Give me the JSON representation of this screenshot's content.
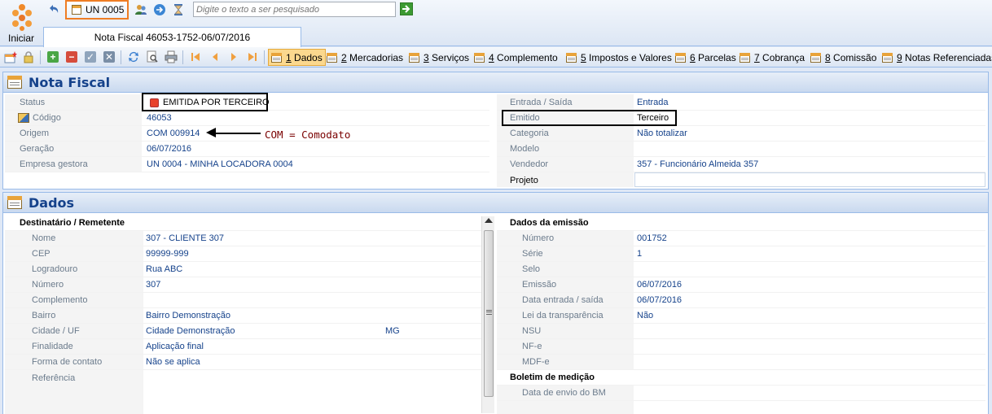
{
  "top": {
    "start_label": "Iniciar",
    "unit_label": "UN 0005",
    "search_placeholder": "Digite o texto a ser pesquisado"
  },
  "document_tab": "Nota Fiscal 46053-1752-06/07/2016",
  "nav_tabs": [
    {
      "num": "1",
      "label": " Dados",
      "active": true
    },
    {
      "num": "2",
      "label": " Mercadorias"
    },
    {
      "num": "3",
      "label": " Serviços"
    },
    {
      "num": "4",
      "label": " Complemento"
    },
    {
      "num": "5",
      "label": " Impostos e Valores"
    },
    {
      "num": "6",
      "label": " Parcelas"
    },
    {
      "num": "7",
      "label": " Cobrança"
    },
    {
      "num": "8",
      "label": " Comissão"
    },
    {
      "num": "9",
      "label": " Notas Referenciadas"
    }
  ],
  "nota": {
    "title": "Nota Fiscal",
    "left": [
      {
        "label": "Status",
        "value": "EMITIDA POR TERCEIRO"
      },
      {
        "label": "Código",
        "value": "46053"
      },
      {
        "label": "Origem",
        "value": "COM 009914"
      },
      {
        "label": "Geração",
        "value": "06/07/2016"
      },
      {
        "label": "Empresa gestora",
        "value": "UN 0004 - MINHA LOCADORA 0004"
      }
    ],
    "right": [
      {
        "label": "Entrada / Saída",
        "value": "Entrada"
      },
      {
        "label": "Emitido",
        "value": "Terceiro"
      },
      {
        "label": "Categoria",
        "value": "Não totalizar"
      },
      {
        "label": "Modelo",
        "value": ""
      },
      {
        "label": "Vendedor",
        "value": "357 - Funcionário Almeida 357"
      },
      {
        "label": "Projeto",
        "value": ""
      }
    ],
    "annotation": "COM = Comodato"
  },
  "dados": {
    "title": "Dados",
    "left_header": "Destinatário / Remetente",
    "left": [
      {
        "label": "Nome",
        "value": "307 - CLIENTE  307"
      },
      {
        "label": "CEP",
        "value": "99999-999"
      },
      {
        "label": "Logradouro",
        "value": "Rua ABC"
      },
      {
        "label": "Número",
        "value": "307"
      },
      {
        "label": "Complemento",
        "value": ""
      },
      {
        "label": "Bairro",
        "value": "Bairro Demonstração"
      },
      {
        "label": "Cidade / UF",
        "value": "Cidade Demonstração",
        "extra": "MG"
      },
      {
        "label": "Finalidade",
        "value": "Aplicação final"
      },
      {
        "label": "Forma de contato",
        "value": "Não se aplica"
      },
      {
        "label": "Referência",
        "value": ""
      }
    ],
    "right_header": "Dados da emissão",
    "right": [
      {
        "label": "Número",
        "value": "001752"
      },
      {
        "label": "Série",
        "value": "1"
      },
      {
        "label": "Selo",
        "value": ""
      },
      {
        "label": "Emissão",
        "value": "06/07/2016"
      },
      {
        "label": "Data entrada / saída",
        "value": "06/07/2016"
      },
      {
        "label": "Lei da transparência",
        "value": "Não"
      },
      {
        "label": "NSU",
        "value": ""
      },
      {
        "label": "NF-e",
        "value": ""
      },
      {
        "label": "MDF-e",
        "value": ""
      }
    ],
    "right_header2": "Boletim de medição",
    "right2": [
      {
        "label": "Data de envio do BM",
        "value": ""
      }
    ]
  },
  "colors": {
    "accent": "#ef7d24",
    "status_red": "#e8412a",
    "header_text": "#15428b",
    "active_tab": "#fbd88e"
  }
}
